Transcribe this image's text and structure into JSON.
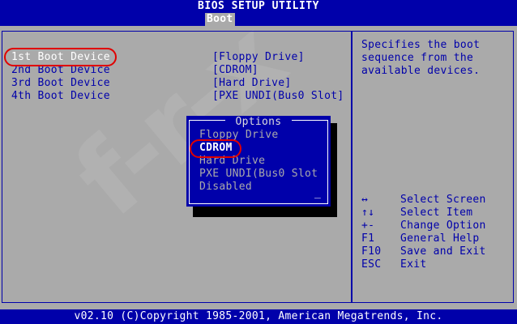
{
  "header": {
    "title": "BIOS SETUP UTILITY",
    "active_tab": "Boot"
  },
  "boot_devices": [
    {
      "label": "1st Boot Device",
      "value": "[Floppy Drive]"
    },
    {
      "label": "2nd Boot Device",
      "value": "[CDROM]"
    },
    {
      "label": "3rd Boot Device",
      "value": "[Hard Drive]"
    },
    {
      "label": "4th Boot Device",
      "value": "[PXE UNDI(Bus0 Slot]"
    }
  ],
  "help": {
    "lines": [
      "Specifies the boot",
      "sequence from the",
      "available devices."
    ]
  },
  "keys": [
    {
      "key": "↔",
      "action": "Select Screen"
    },
    {
      "key": "↑↓",
      "action": "Select Item"
    },
    {
      "key": "+-",
      "action": "Change Option"
    },
    {
      "key": "F1",
      "action": "General Help"
    },
    {
      "key": "F10",
      "action": "Save and Exit"
    },
    {
      "key": "ESC",
      "action": "Exit"
    }
  ],
  "options_popup": {
    "title": "Options",
    "items": [
      "Floppy Drive",
      "CDROM",
      "Hard Drive",
      "PXE UNDI(Bus0 Slot",
      "Disabled"
    ],
    "selected": "CDROM"
  },
  "footer": {
    "text": "v02.10 (C)Copyright 1985-2001, American Megatrends, Inc."
  },
  "colors": {
    "background": "#aaaaaa",
    "accent": "#0000aa",
    "highlight": "#ffffff",
    "annotation": "#e00000"
  }
}
